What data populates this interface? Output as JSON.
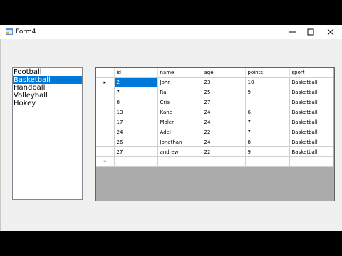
{
  "window": {
    "title": "Form4"
  },
  "listbox": {
    "items": [
      "Football",
      "Basketball",
      "Handball",
      "Volleyball",
      "Hokey"
    ],
    "selected_index": 1
  },
  "grid": {
    "columns": [
      "id",
      "name",
      "age",
      "points",
      "sport"
    ],
    "rows": [
      [
        "2",
        "John",
        "23",
        "10",
        "Basketball"
      ],
      [
        "7",
        "Raj",
        "25",
        "9",
        "Basketball"
      ],
      [
        "8",
        "Cris",
        "27",
        "",
        "Basketball"
      ],
      [
        "13",
        "Kane",
        "24",
        "6",
        "Basketball"
      ],
      [
        "17",
        "Moler",
        "24",
        "7",
        "Basketball"
      ],
      [
        "24",
        "Adel",
        "22",
        "7",
        "Basketball"
      ],
      [
        "26",
        "Jonathan",
        "24",
        "8",
        "Basketball"
      ],
      [
        "27",
        "andrew",
        "22",
        "9",
        "Basketball"
      ]
    ],
    "current_row_marker": "▸",
    "new_row_marker": "*"
  },
  "colors": {
    "selection": "#0078d7",
    "grid_background": "#ababab"
  }
}
